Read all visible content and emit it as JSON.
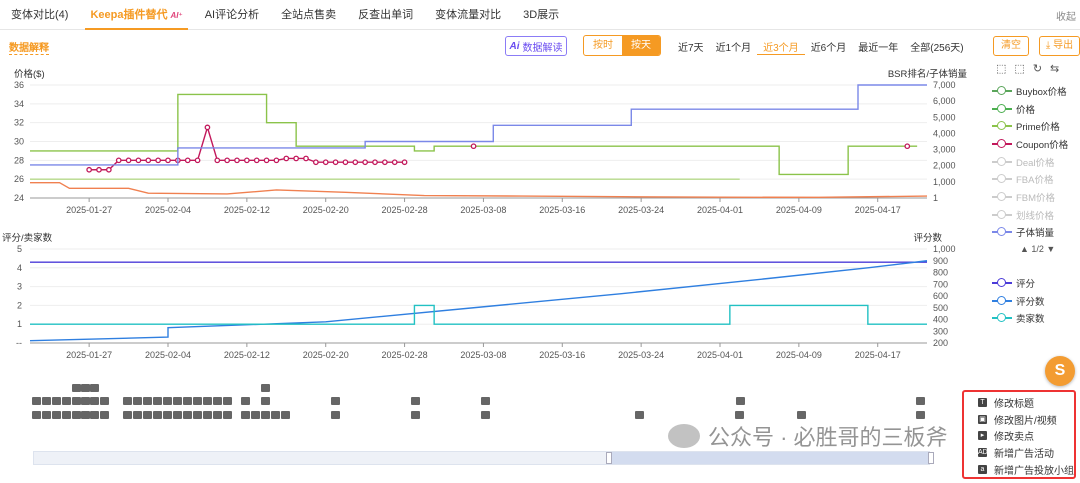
{
  "tabs": [
    {
      "label": "变体对比(4)"
    },
    {
      "label": "Keepa插件替代",
      "badge": "AI⁺"
    },
    {
      "label": "AI评论分析"
    },
    {
      "label": "全站点售卖"
    },
    {
      "label": "反查出单词"
    },
    {
      "label": "变体流量对比"
    },
    {
      "label": "3D展示"
    }
  ],
  "collapse_label": "收起",
  "data_explain": "数据解释",
  "ai_button": {
    "icon": "Ai",
    "label": "数据解读"
  },
  "granularity": {
    "options": [
      "按时",
      "按天"
    ],
    "selected": "按天"
  },
  "ranges": {
    "options": [
      "近7天",
      "近1个月",
      "近3个月",
      "近6个月",
      "最近一年",
      "全部(256天)"
    ],
    "selected": "近3个月"
  },
  "clear_label": "清空",
  "export_label": "导出",
  "tool_icons": [
    "crop-icon",
    "crop-icon",
    "refresh-icon",
    "swap-icon"
  ],
  "legend_top": [
    {
      "name": "Buybox价格",
      "color": "#5aa55a",
      "dim": false
    },
    {
      "name": "价格",
      "color": "#4caf50",
      "dim": false
    },
    {
      "name": "Prime价格",
      "color": "#8bc34a",
      "dim": false
    },
    {
      "name": "Coupon价格",
      "color": "#c2185b",
      "dim": false
    },
    {
      "name": "Deal价格",
      "color": "#cccccc",
      "dim": true
    },
    {
      "name": "FBA价格",
      "color": "#cccccc",
      "dim": true
    },
    {
      "name": "FBM价格",
      "color": "#cccccc",
      "dim": true
    },
    {
      "name": "划线价格",
      "color": "#cccccc",
      "dim": true
    },
    {
      "name": "子体销量",
      "color": "#7b88e8",
      "dim": false
    }
  ],
  "legend_pager": "▲ 1/2 ▼",
  "legend_bottom": [
    {
      "name": "评分",
      "color": "#4b3bd8"
    },
    {
      "name": "评分数",
      "color": "#2f7fe0"
    },
    {
      "name": "卖家数",
      "color": "#22c1c3"
    }
  ],
  "chart_data": [
    {
      "type": "line",
      "ylabel": "价格($)",
      "y2label": "BSR排名/子体销量",
      "ylim": [
        24,
        36
      ],
      "y2lim": [
        0,
        7000
      ],
      "yticks": [
        24,
        26,
        28,
        30,
        32,
        34,
        36
      ],
      "y2ticks": [
        "1",
        "1,000",
        "2,000",
        "3,000",
        "4,000",
        "5,000",
        "6,000",
        "7,000"
      ],
      "xticks": [
        "2025-01-27",
        "2025-02-04",
        "2025-02-12",
        "2025-02-20",
        "2025-02-28",
        "2025-03-08",
        "2025-03-16",
        "2025-03-24",
        "2025-04-01",
        "2025-04-09",
        "2025-04-17"
      ],
      "xdomain_days": [
        0,
        91
      ],
      "series": [
        {
          "name": "价格",
          "color": "#8bc34a",
          "step": true,
          "points": [
            [
              0,
              29
            ],
            [
              15,
              29
            ],
            [
              15,
              35
            ],
            [
              24,
              35
            ],
            [
              24,
              32
            ],
            [
              27,
              32
            ],
            [
              27,
              29.5
            ],
            [
              39,
              29.5
            ],
            [
              39,
              29.0
            ],
            [
              41,
              29.0
            ],
            [
              41,
              29.5
            ],
            [
              76,
              29.5
            ],
            [
              76,
              26.5
            ],
            [
              83,
              26.5
            ],
            [
              83,
              29.5
            ],
            [
              90,
              29.5
            ]
          ]
        },
        {
          "name": "Prime价格",
          "color": "#b5d98a",
          "step": false,
          "points": [
            [
              0,
              26
            ],
            [
              4,
              26
            ],
            [
              65,
              26
            ],
            [
              72,
              26
            ]
          ]
        },
        {
          "name": "Coupon价格",
          "color": "#c2185b",
          "markers": true,
          "points": [
            [
              6,
              27
            ],
            [
              7,
              27
            ],
            [
              8,
              27
            ],
            [
              9,
              28
            ],
            [
              10,
              28
            ],
            [
              11,
              28
            ],
            [
              12,
              28
            ],
            [
              13,
              28
            ],
            [
              14,
              28
            ],
            [
              15,
              28
            ],
            [
              16,
              28
            ],
            [
              17,
              28
            ],
            [
              18,
              31.5
            ],
            [
              19,
              28
            ],
            [
              20,
              28
            ],
            [
              21,
              28
            ],
            [
              22,
              28
            ],
            [
              23,
              28
            ],
            [
              24,
              28
            ],
            [
              25,
              28
            ],
            [
              26,
              28.2
            ],
            [
              27,
              28.2
            ],
            [
              28,
              28.2
            ],
            [
              29,
              27.8
            ],
            [
              30,
              27.8
            ],
            [
              31,
              27.8
            ],
            [
              32,
              27.8
            ],
            [
              33,
              27.8
            ],
            [
              34,
              27.8
            ],
            [
              35,
              27.8
            ],
            [
              36,
              27.8
            ],
            [
              37,
              27.8
            ],
            [
              38,
              27.8
            ]
          ],
          "extra": [
            [
              45,
              29.5
            ],
            [
              89,
              29.5
            ]
          ]
        },
        {
          "name": "子体销量",
          "color": "#7b88e8",
          "step": true,
          "y2": true,
          "points": [
            [
              0,
              2050
            ],
            [
              15,
              2050
            ],
            [
              15,
              3100
            ],
            [
              34,
              3100
            ],
            [
              34,
              3500
            ],
            [
              47,
              3500
            ],
            [
              47,
              4500
            ],
            [
              61,
              4500
            ],
            [
              61,
              5500
            ],
            [
              84,
              5500
            ],
            [
              84,
              7000
            ],
            [
              91,
              7000
            ]
          ]
        },
        {
          "name": "BSR",
          "color": "#f08050",
          "step": false,
          "y2": true,
          "points": [
            [
              0,
              950
            ],
            [
              3,
              950
            ],
            [
              4,
              600
            ],
            [
              10,
              600
            ],
            [
              12,
              300
            ],
            [
              20,
              250
            ],
            [
              25,
              500
            ],
            [
              32,
              350
            ],
            [
              40,
              150
            ],
            [
              50,
              120
            ],
            [
              60,
              80
            ],
            [
              70,
              50
            ],
            [
              80,
              40
            ],
            [
              91,
              120
            ]
          ]
        }
      ]
    },
    {
      "type": "line",
      "ylabel": "评分/卖家数",
      "y2label": "评分数",
      "ylim": [
        0,
        5
      ],
      "y2lim": [
        200,
        1000
      ],
      "yticks": [
        "--",
        "1",
        "2",
        "3",
        "4",
        "5"
      ],
      "y2ticks": [
        "200",
        "300",
        "400",
        "500",
        "600",
        "700",
        "800",
        "900",
        "1,000"
      ],
      "xticks": [
        "2025-01-27",
        "2025-02-04",
        "2025-02-12",
        "2025-02-20",
        "2025-02-28",
        "2025-03-08",
        "2025-03-16",
        "2025-03-24",
        "2025-04-01",
        "2025-04-09",
        "2025-04-17"
      ],
      "series": [
        {
          "name": "评分",
          "color": "#4b3bd8",
          "points": [
            [
              0,
              4.3
            ],
            [
              91,
              4.3
            ]
          ]
        },
        {
          "name": "评分数",
          "color": "#2f7fe0",
          "y2": true,
          "points": [
            [
              0,
              220
            ],
            [
              14,
              250
            ],
            [
              14,
              330
            ],
            [
              30,
              380
            ],
            [
              45,
              500
            ],
            [
              60,
              620
            ],
            [
              75,
              750
            ],
            [
              85,
              840
            ],
            [
              91,
              900
            ]
          ]
        },
        {
          "name": "卖家数",
          "color": "#22c1c3",
          "step": true,
          "points": [
            [
              0,
              1
            ],
            [
              39,
              1
            ],
            [
              39,
              2
            ],
            [
              41,
              2
            ],
            [
              41,
              1
            ],
            [
              71,
              1
            ],
            [
              71,
              2
            ],
            [
              85,
              2
            ],
            [
              85,
              1
            ],
            [
              91,
              1
            ]
          ]
        }
      ]
    }
  ],
  "menu": [
    {
      "icon": "T",
      "label": "修改标题"
    },
    {
      "icon": "▣",
      "label": "修改图片/视频"
    },
    {
      "icon": "▸",
      "label": "修改卖点"
    },
    {
      "icon": "AD",
      "label": "新增广告活动"
    },
    {
      "icon": "a",
      "label": "新增广告投放小组"
    }
  ],
  "fab_label": "S",
  "watermark": "公众号 · 必胜哥的三板斧"
}
